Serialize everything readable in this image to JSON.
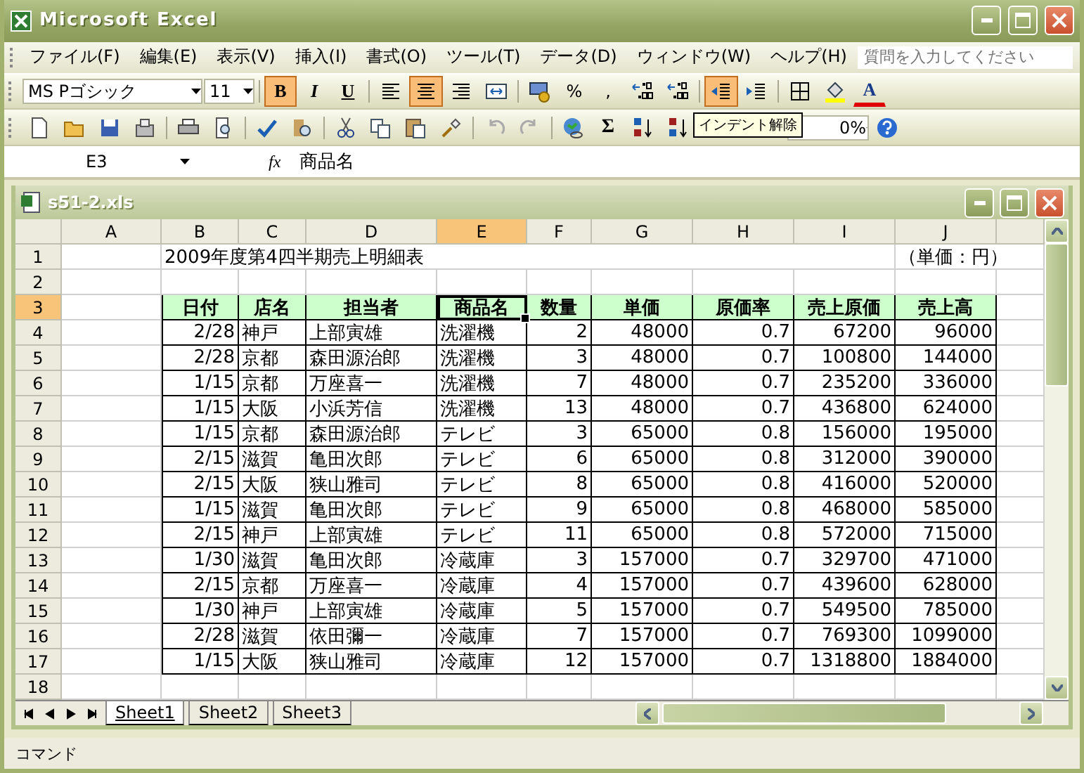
{
  "window": {
    "title": "Microsoft Excel"
  },
  "menu": [
    "ファイル(F)",
    "編集(E)",
    "表示(V)",
    "挿入(I)",
    "書式(O)",
    "ツール(T)",
    "データ(D)",
    "ウィンドウ(W)",
    "ヘルプ(H)"
  ],
  "help_search": {
    "placeholder": "質問を入力してください"
  },
  "format_toolbar": {
    "font": "MS Pゴシック",
    "size": "11",
    "buttons": [
      {
        "kind": "bold",
        "label": "B",
        "pressed": true
      },
      {
        "kind": "italic",
        "label": "I",
        "pressed": false
      },
      {
        "kind": "underline",
        "label": "U",
        "pressed": false
      },
      {
        "kind": "align-left",
        "pressed": false
      },
      {
        "kind": "align-center",
        "pressed": true
      },
      {
        "kind": "align-right",
        "pressed": false
      },
      {
        "kind": "merge",
        "pressed": false
      },
      {
        "kind": "currency",
        "pressed": false
      },
      {
        "kind": "text",
        "label": "%",
        "pressed": false
      },
      {
        "kind": "text",
        "label": ",",
        "pressed": false
      },
      {
        "kind": "inc-decimal",
        "pressed": false
      },
      {
        "kind": "dec-decimal",
        "pressed": false
      },
      {
        "kind": "outdent",
        "pressed": true
      },
      {
        "kind": "indent",
        "pressed": false
      },
      {
        "kind": "borders",
        "pressed": false
      },
      {
        "kind": "fill",
        "pressed": false
      },
      {
        "kind": "font-color",
        "label": "A",
        "pressed": false
      }
    ]
  },
  "standard_toolbar": {
    "buttons": [
      {
        "kind": "new"
      },
      {
        "kind": "open"
      },
      {
        "kind": "save"
      },
      {
        "kind": "permission"
      },
      {
        "kind": "print"
      },
      {
        "kind": "preview"
      },
      {
        "kind": "spelling"
      },
      {
        "kind": "research"
      },
      {
        "kind": "cut"
      },
      {
        "kind": "copy"
      },
      {
        "kind": "paste"
      },
      {
        "kind": "painter"
      },
      {
        "kind": "undo"
      },
      {
        "kind": "redo"
      },
      {
        "kind": "hyperlink"
      },
      {
        "kind": "text",
        "label": "Σ"
      },
      {
        "kind": "sort-asc"
      },
      {
        "kind": "sort-desc"
      }
    ],
    "zoom": "0%",
    "tooltip": "インデント解除"
  },
  "formula_bar": {
    "name_box": "E3",
    "fx": "fx",
    "value": "商品名"
  },
  "workbook": {
    "title": "s51-2.xls",
    "columns": [
      {
        "label": "A",
        "selected": false
      },
      {
        "label": "B",
        "selected": false
      },
      {
        "label": "C",
        "selected": false
      },
      {
        "label": "D",
        "selected": false
      },
      {
        "label": "E",
        "selected": true
      },
      {
        "label": "F",
        "selected": false
      },
      {
        "label": "G",
        "selected": false
      },
      {
        "label": "H",
        "selected": false
      },
      {
        "label": "I",
        "selected": false
      },
      {
        "label": "J",
        "selected": false
      }
    ],
    "rows": [
      {
        "number": "1",
        "kind": "title",
        "selected": false,
        "cells": [
          null,
          "2009年度第4四半期売上明細表",
          null,
          null,
          null,
          null,
          null,
          null,
          null,
          "（単価：円）"
        ]
      },
      {
        "number": "2",
        "kind": "blank",
        "selected": false,
        "cells": []
      },
      {
        "number": "3",
        "kind": "header",
        "selected": true,
        "cells": [
          null,
          "日付",
          "店名",
          "担当者",
          "商品名",
          "数量",
          "単価",
          "原価率",
          "売上原価",
          "売上高"
        ]
      },
      {
        "number": "4",
        "kind": "data",
        "selected": false,
        "cells": [
          null,
          "2/28",
          "神戸",
          "上部寅雄",
          "洗濯機",
          "2",
          "48000",
          "0.7",
          "67200",
          "96000"
        ]
      },
      {
        "number": "5",
        "kind": "data",
        "selected": false,
        "cells": [
          null,
          "2/28",
          "京都",
          "森田源治郎",
          "洗濯機",
          "3",
          "48000",
          "0.7",
          "100800",
          "144000"
        ]
      },
      {
        "number": "6",
        "kind": "data",
        "selected": false,
        "cells": [
          null,
          "1/15",
          "京都",
          "万座喜一",
          "洗濯機",
          "7",
          "48000",
          "0.7",
          "235200",
          "336000"
        ]
      },
      {
        "number": "7",
        "kind": "data",
        "selected": false,
        "cells": [
          null,
          "1/15",
          "大阪",
          "小浜芳信",
          "洗濯機",
          "13",
          "48000",
          "0.7",
          "436800",
          "624000"
        ]
      },
      {
        "number": "8",
        "kind": "data",
        "selected": false,
        "cells": [
          null,
          "1/15",
          "京都",
          "森田源治郎",
          "テレビ",
          "3",
          "65000",
          "0.8",
          "156000",
          "195000"
        ]
      },
      {
        "number": "9",
        "kind": "data",
        "selected": false,
        "cells": [
          null,
          "2/15",
          "滋賀",
          "亀田次郎",
          "テレビ",
          "6",
          "65000",
          "0.8",
          "312000",
          "390000"
        ]
      },
      {
        "number": "10",
        "kind": "data",
        "selected": false,
        "cells": [
          null,
          "2/15",
          "大阪",
          "狭山雅司",
          "テレビ",
          "8",
          "65000",
          "0.8",
          "416000",
          "520000"
        ]
      },
      {
        "number": "11",
        "kind": "data",
        "selected": false,
        "cells": [
          null,
          "1/15",
          "滋賀",
          "亀田次郎",
          "テレビ",
          "9",
          "65000",
          "0.8",
          "468000",
          "585000"
        ]
      },
      {
        "number": "12",
        "kind": "data",
        "selected": false,
        "cells": [
          null,
          "2/15",
          "神戸",
          "上部寅雄",
          "テレビ",
          "11",
          "65000",
          "0.8",
          "572000",
          "715000"
        ]
      },
      {
        "number": "13",
        "kind": "data",
        "selected": false,
        "cells": [
          null,
          "1/30",
          "滋賀",
          "亀田次郎",
          "冷蔵庫",
          "3",
          "157000",
          "0.7",
          "329700",
          "471000"
        ]
      },
      {
        "number": "14",
        "kind": "data",
        "selected": false,
        "cells": [
          null,
          "2/15",
          "京都",
          "万座喜一",
          "冷蔵庫",
          "4",
          "157000",
          "0.7",
          "439600",
          "628000"
        ]
      },
      {
        "number": "15",
        "kind": "data",
        "selected": false,
        "cells": [
          null,
          "1/30",
          "神戸",
          "上部寅雄",
          "冷蔵庫",
          "5",
          "157000",
          "0.7",
          "549500",
          "785000"
        ]
      },
      {
        "number": "16",
        "kind": "data",
        "selected": false,
        "cells": [
          null,
          "2/28",
          "滋賀",
          "依田彌一",
          "冷蔵庫",
          "7",
          "157000",
          "0.7",
          "769300",
          "1099000"
        ]
      },
      {
        "number": "17",
        "kind": "data",
        "selected": false,
        "cells": [
          null,
          "1/15",
          "大阪",
          "狭山雅司",
          "冷蔵庫",
          "12",
          "157000",
          "0.7",
          "1318800",
          "1884000"
        ]
      },
      {
        "number": "18",
        "kind": "blank",
        "selected": false,
        "cells": []
      }
    ],
    "sheets": [
      {
        "label": "Sheet1",
        "selected": true
      },
      {
        "label": "Sheet2",
        "selected": false
      },
      {
        "label": "Sheet3",
        "selected": false
      }
    ]
  },
  "status_bar": {
    "text": "コマンド"
  }
}
